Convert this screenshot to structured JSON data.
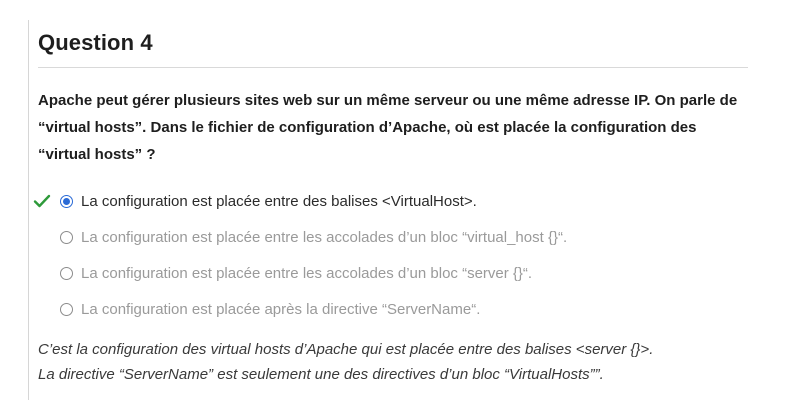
{
  "question": {
    "title": "Question 4",
    "text": "Apache peut gérer plusieurs sites web sur un même serveur ou une même adresse IP. On parle de “virtual hosts”. Dans le fichier de configuration d’Apache, où est placée la configuration des “virtual hosts” ?"
  },
  "options": [
    {
      "label": "La configuration est placée entre des balises <VirtualHost>.",
      "selected": true,
      "correct": true
    },
    {
      "label": "La configuration est placée entre les accolades d’un bloc “virtual_host {}“.",
      "selected": false,
      "correct": false
    },
    {
      "label": "La configuration est placée entre les accolades d’un bloc “server {}“.",
      "selected": false,
      "correct": false
    },
    {
      "label": "La configuration est placée après la directive “ServerName“.",
      "selected": false,
      "correct": false
    }
  ],
  "explanation": {
    "line1": "C’est la configuration des virtual hosts d’Apache qui est placée entre des balises <server {}>.",
    "line2": "La directive “ServerName” est seulement une des directives d’un bloc “VirtualHosts””."
  },
  "colors": {
    "correct_check": "#2e9a3a",
    "selected_radio": "#2a6ad6",
    "muted_option_text": "#9a9a9a"
  },
  "icons": {
    "correct": "check-icon"
  }
}
